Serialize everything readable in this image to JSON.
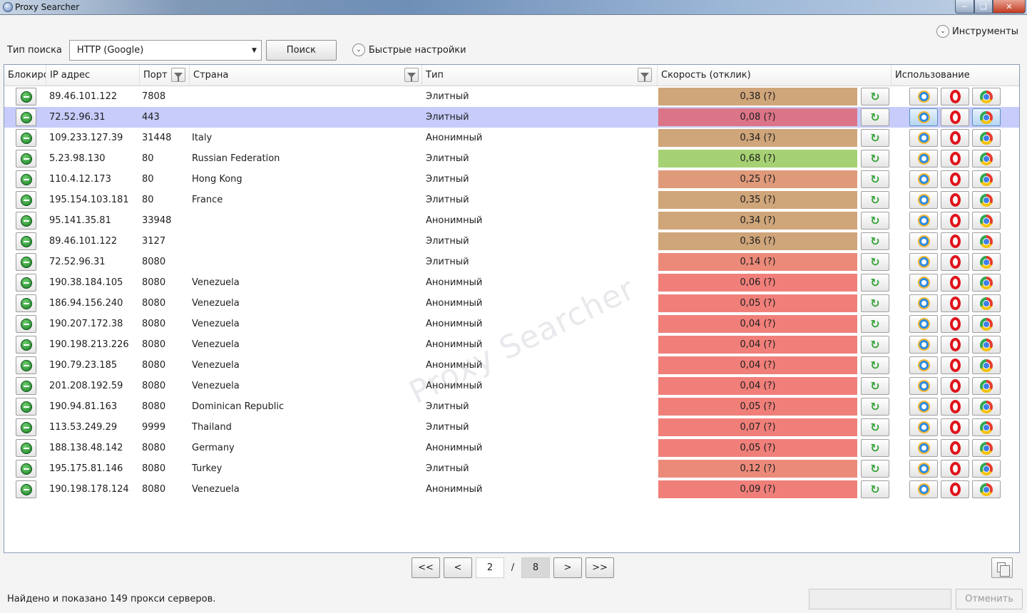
{
  "window": {
    "title": "Proxy Searcher"
  },
  "toolbar": {
    "tools_label": "Инструменты",
    "search_type_label": "Тип поиска",
    "search_type_value": "HTTP (Google)",
    "search_button": "Поиск",
    "quick_settings_label": "Быстрые настройки"
  },
  "grid": {
    "columns": {
      "block": "Блокиро",
      "ip": "IP адрес",
      "port": "Порт",
      "country": "Страна",
      "type": "Тип",
      "speed": "Скорость (отклик)",
      "usage": "Использование"
    },
    "rows": [
      {
        "ip": "89.46.101.122",
        "port": "7808",
        "country": "",
        "type": "Элитный",
        "speed": "0,38 (?)",
        "speed_color": "#cfa57a"
      },
      {
        "ip": "72.52.96.31",
        "port": "443",
        "country": "",
        "type": "Элитный",
        "speed": "0,08 (?)",
        "speed_color": "#dc7488"
      },
      {
        "ip": "109.233.127.39",
        "port": "31448",
        "country": "Italy",
        "type": "Анонимный",
        "speed": "0,34 (?)",
        "speed_color": "#cfa57a"
      },
      {
        "ip": "5.23.98.130",
        "port": "80",
        "country": "Russian Federation",
        "type": "Элитный",
        "speed": "0,68 (?)",
        "speed_color": "#a5d174"
      },
      {
        "ip": "110.4.12.173",
        "port": "80",
        "country": "Hong Kong",
        "type": "Элитный",
        "speed": "0,25 (?)",
        "speed_color": "#df9a7a"
      },
      {
        "ip": "195.154.103.181",
        "port": "80",
        "country": "France",
        "type": "Элитный",
        "speed": "0,35 (?)",
        "speed_color": "#cfa57a"
      },
      {
        "ip": "95.141.35.81",
        "port": "33948",
        "country": "",
        "type": "Анонимный",
        "speed": "0,34 (?)",
        "speed_color": "#cfa57a"
      },
      {
        "ip": "89.46.101.122",
        "port": "3127",
        "country": "",
        "type": "Элитный",
        "speed": "0,36 (?)",
        "speed_color": "#cfa57a"
      },
      {
        "ip": "72.52.96.31",
        "port": "8080",
        "country": "",
        "type": "Элитный",
        "speed": "0,14 (?)",
        "speed_color": "#ec8a7a"
      },
      {
        "ip": "190.38.184.105",
        "port": "8080",
        "country": "Venezuela",
        "type": "Анонимный",
        "speed": "0,06 (?)",
        "speed_color": "#f07f7a"
      },
      {
        "ip": "186.94.156.240",
        "port": "8080",
        "country": "Venezuela",
        "type": "Анонимный",
        "speed": "0,05 (?)",
        "speed_color": "#f07f7a"
      },
      {
        "ip": "190.207.172.38",
        "port": "8080",
        "country": "Venezuela",
        "type": "Анонимный",
        "speed": "0,04 (?)",
        "speed_color": "#f07f7a"
      },
      {
        "ip": "190.198.213.226",
        "port": "8080",
        "country": "Venezuela",
        "type": "Анонимный",
        "speed": "0,04 (?)",
        "speed_color": "#f07f7a"
      },
      {
        "ip": "190.79.23.185",
        "port": "8080",
        "country": "Venezuela",
        "type": "Анонимный",
        "speed": "0,04 (?)",
        "speed_color": "#f07f7a"
      },
      {
        "ip": "201.208.192.59",
        "port": "8080",
        "country": "Venezuela",
        "type": "Анонимный",
        "speed": "0,04 (?)",
        "speed_color": "#f07f7a"
      },
      {
        "ip": "190.94.81.163",
        "port": "8080",
        "country": "Dominican Republic",
        "type": "Элитный",
        "speed": "0,05 (?)",
        "speed_color": "#f07f7a"
      },
      {
        "ip": "113.53.249.29",
        "port": "9999",
        "country": "Thailand",
        "type": "Элитный",
        "speed": "0,07 (?)",
        "speed_color": "#f07f7a"
      },
      {
        "ip": "188.138.48.142",
        "port": "8080",
        "country": "Germany",
        "type": "Анонимный",
        "speed": "0,05 (?)",
        "speed_color": "#f07f7a"
      },
      {
        "ip": "195.175.81.146",
        "port": "8080",
        "country": "Turkey",
        "type": "Элитный",
        "speed": "0,12 (?)",
        "speed_color": "#ec8a7a"
      },
      {
        "ip": "190.198.178.124",
        "port": "8080",
        "country": "Venezuela",
        "type": "Анонимный",
        "speed": "0,09 (?)",
        "speed_color": "#f07f7a"
      }
    ],
    "selected_row": 1,
    "watermark": "Proxy Searcher"
  },
  "pager": {
    "first": "<<",
    "prev": "<",
    "current_page": "2",
    "separator": "/",
    "total_pages": "8",
    "next": ">",
    "last": ">>"
  },
  "status": {
    "text": "Найдено и показано 149 прокси серверов.",
    "cancel_button": "Отменить"
  }
}
